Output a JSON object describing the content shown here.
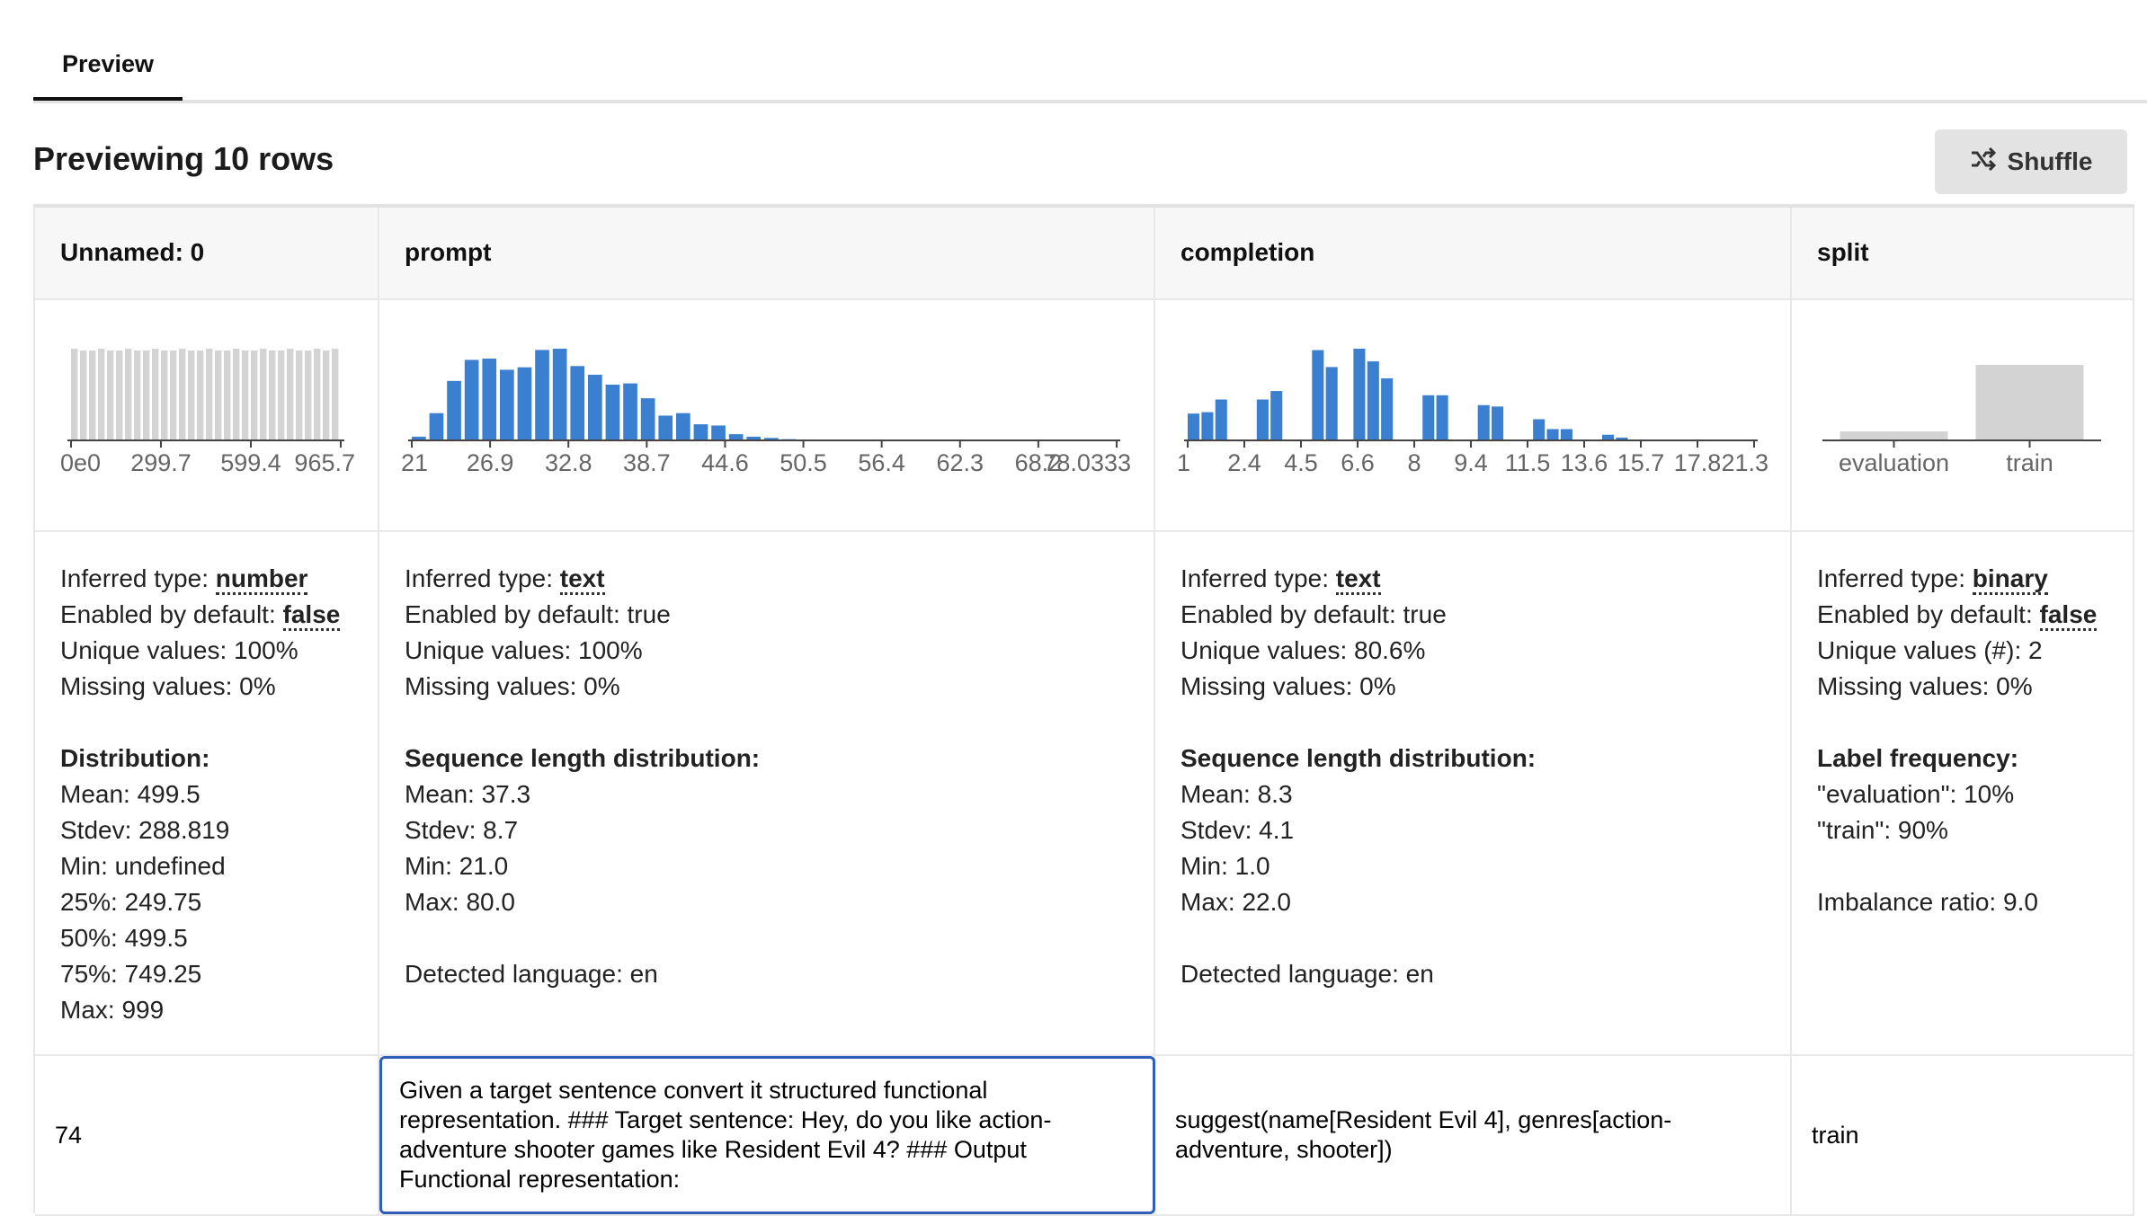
{
  "tabs": {
    "preview_label": "Preview"
  },
  "heading": "Previewing 10 rows",
  "shuffle": {
    "label": "Shuffle",
    "icon": "shuffle-icon"
  },
  "colors": {
    "bar_blue": "#3b7fd1",
    "bar_gray": "#d3d3d3",
    "focus_border": "#2f5dba"
  },
  "columns": [
    {
      "header": "Unnamed: 0",
      "stats": [
        {
          "label": "Inferred type: ",
          "value": "number",
          "style": "dotted"
        },
        {
          "label": "Enabled by default: ",
          "value": "false",
          "style": "dotted"
        },
        {
          "label": "Unique values: 100%"
        },
        {
          "label": "Missing values: 0%"
        },
        {
          "label": ""
        },
        {
          "label": "Distribution:",
          "style": "bold"
        },
        {
          "label": "Mean: 499.5"
        },
        {
          "label": "Stdev: 288.819"
        },
        {
          "label": "Min: undefined"
        },
        {
          "label": "25%: 249.75"
        },
        {
          "label": "50%: 499.5"
        },
        {
          "label": "75%: 749.25"
        },
        {
          "label": "Max: 999"
        }
      ]
    },
    {
      "header": "prompt",
      "stats": [
        {
          "label": "Inferred type: ",
          "value": "text",
          "style": "dotted"
        },
        {
          "label": "Enabled by default: true"
        },
        {
          "label": "Unique values: 100%"
        },
        {
          "label": "Missing values: 0%"
        },
        {
          "label": ""
        },
        {
          "label": "Sequence length distribution:",
          "style": "bold"
        },
        {
          "label": "Mean: 37.3"
        },
        {
          "label": "Stdev: 8.7"
        },
        {
          "label": "Min: 21.0"
        },
        {
          "label": "Max: 80.0"
        },
        {
          "label": ""
        },
        {
          "label": "Detected language: en"
        }
      ]
    },
    {
      "header": "completion",
      "stats": [
        {
          "label": "Inferred type: ",
          "value": "text",
          "style": "dotted"
        },
        {
          "label": "Enabled by default: true"
        },
        {
          "label": "Unique values: 80.6%"
        },
        {
          "label": "Missing values: 0%"
        },
        {
          "label": ""
        },
        {
          "label": "Sequence length distribution:",
          "style": "bold"
        },
        {
          "label": "Mean: 8.3"
        },
        {
          "label": "Stdev: 4.1"
        },
        {
          "label": "Min: 1.0"
        },
        {
          "label": "Max: 22.0"
        },
        {
          "label": ""
        },
        {
          "label": "Detected language: en"
        }
      ]
    },
    {
      "header": "split",
      "stats": [
        {
          "label": "Inferred type: ",
          "value": "binary",
          "style": "dotted"
        },
        {
          "label": "Enabled by default: ",
          "value": "false",
          "style": "dotted"
        },
        {
          "label": "Unique values (#): 2"
        },
        {
          "label": "Missing values: 0%"
        },
        {
          "label": ""
        },
        {
          "label": "Label frequency:",
          "style": "bold"
        },
        {
          "label": "\"evaluation\": 10%"
        },
        {
          "label": "\"train\": 90%"
        },
        {
          "label": ""
        },
        {
          "label": "Imbalance ratio: 9.0"
        }
      ]
    }
  ],
  "chart_data": [
    {
      "type": "bar",
      "column": "Unnamed: 0",
      "color": "#d3d3d3",
      "tick_labels": [
        "0e0",
        "299.7",
        "599.4",
        "965.7"
      ],
      "values": [
        1,
        0.98,
        0.98,
        1,
        0.98,
        0.98,
        1,
        0.98,
        0.98,
        1,
        0.98,
        0.98,
        1,
        0.98,
        0.98,
        1,
        0.98,
        0.98,
        1,
        0.98,
        0.98,
        1,
        0.98,
        0.98,
        1,
        0.98,
        0.98,
        1,
        0.98,
        1
      ],
      "grid": false
    },
    {
      "type": "bar",
      "column": "prompt",
      "color": "#3b7fd1",
      "tick_labels": [
        "21",
        "26.9",
        "32.8",
        "38.7",
        "44.6",
        "50.5",
        "56.4",
        "62.3",
        "68.2",
        "78.0333"
      ],
      "values": [
        3,
        22,
        48,
        65,
        66,
        57,
        59,
        73,
        74,
        60,
        53,
        45,
        46,
        34,
        20,
        22,
        13,
        12,
        5,
        3,
        2,
        1,
        0.5,
        0,
        0,
        0,
        0,
        0,
        0,
        0,
        0,
        0,
        0,
        0,
        0,
        0,
        0,
        0,
        0,
        0.5
      ],
      "grid": false
    },
    {
      "type": "bar",
      "column": "completion",
      "color": "#3b7fd1",
      "tick_labels": [
        "1",
        "2.4",
        "4.5",
        "6.6",
        "8",
        "9.4",
        "11.5",
        "13.6",
        "15.7",
        "17.8",
        "21.3"
      ],
      "values": [
        19,
        20,
        29,
        0,
        0,
        29,
        35,
        0,
        0,
        64,
        52,
        0,
        65,
        56,
        44,
        0,
        0,
        32,
        32,
        0,
        0,
        25,
        24,
        0,
        0,
        15,
        8,
        8,
        0,
        0,
        4,
        2,
        0,
        0,
        0,
        0,
        0,
        0,
        0,
        0,
        0
      ],
      "grid": false
    },
    {
      "type": "bar",
      "column": "split",
      "color": "#d3d3d3",
      "categories": [
        "evaluation",
        "train"
      ],
      "values": [
        10,
        90
      ],
      "grid": false
    }
  ],
  "data_rows": [
    {
      "unnamed": "74",
      "prompt": "Given a target sentence convert it structured functional representation. ### Target sentence: Hey, do you like action-adventure shooter games like Resident Evil 4? ### Output Functional representation:",
      "completion": "suggest(name[Resident Evil 4], genres[action-adventure, shooter])",
      "split": "train"
    }
  ]
}
